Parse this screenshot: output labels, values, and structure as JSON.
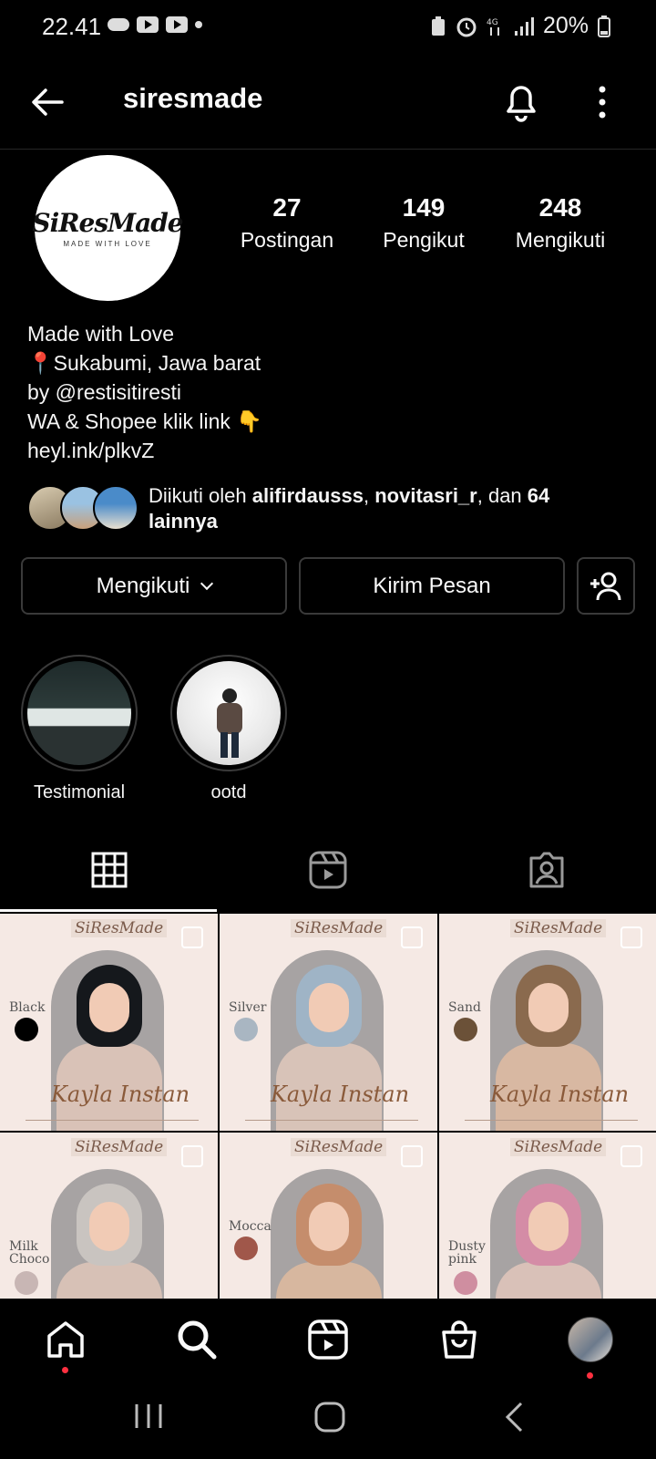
{
  "status_bar": {
    "time": "22.41",
    "battery": "20%",
    "left_icons": [
      "cloud-icon",
      "youtube-icon",
      "youtube-icon",
      "dot-icon"
    ],
    "right_icons": [
      "battery-saver-icon",
      "alarm-icon",
      "4g-icon",
      "signal-icon",
      "battery-icon"
    ]
  },
  "header": {
    "username": "siresmade"
  },
  "profile": {
    "avatar_logo": "SiResMade",
    "avatar_sub": "MADE WITH LOVE",
    "stats": [
      {
        "value": "27",
        "label": "Postingan"
      },
      {
        "value": "149",
        "label": "Pengikut"
      },
      {
        "value": "248",
        "label": "Mengikuti"
      }
    ],
    "bio": [
      "Made with Love",
      "📍Sukabumi, Jawa barat",
      "by @restisitiresti",
      "WA & Shopee klik link 👇",
      "heyl.ink/plkvZ"
    ],
    "followed_by": {
      "prefix": "Diikuti oleh ",
      "user1": "alifirdausss",
      "sep": ", ",
      "user2": "novitasri_r",
      "mid": ", dan ",
      "others": "64 lainnya"
    }
  },
  "buttons": {
    "follow": "Mengikuti",
    "message": "Kirim Pesan"
  },
  "highlights": [
    {
      "label": "Testimonial"
    },
    {
      "label": "ootd"
    }
  ],
  "grid": {
    "brand": "SiResMade",
    "product": "Kayla Instan",
    "posts": [
      {
        "color_name": "Black",
        "swatch": "#000000",
        "hijab": "#15181c",
        "body": "#d9c2b7"
      },
      {
        "color_name": "Silver",
        "swatch": "#a9b6c2",
        "hijab": "#9fb4c6",
        "body": "#d8c3b8"
      },
      {
        "color_name": "Sand",
        "swatch": "#6b5138",
        "hijab": "#8a6a4e",
        "body": "#d8b8a2"
      },
      {
        "color_name": "Milk Choco",
        "swatch": "#c8b6b4",
        "hijab": "#c9c4c0",
        "body": "#d7c1b6"
      },
      {
        "color_name": "Mocca",
        "swatch": "#a0574a",
        "hijab": "#c58d6c",
        "body": "#d7b79f"
      },
      {
        "color_name": "Dusty pink",
        "swatch": "#cf8ea0",
        "hijab": "#d48ca6",
        "body": "#d9c1b8"
      }
    ]
  }
}
